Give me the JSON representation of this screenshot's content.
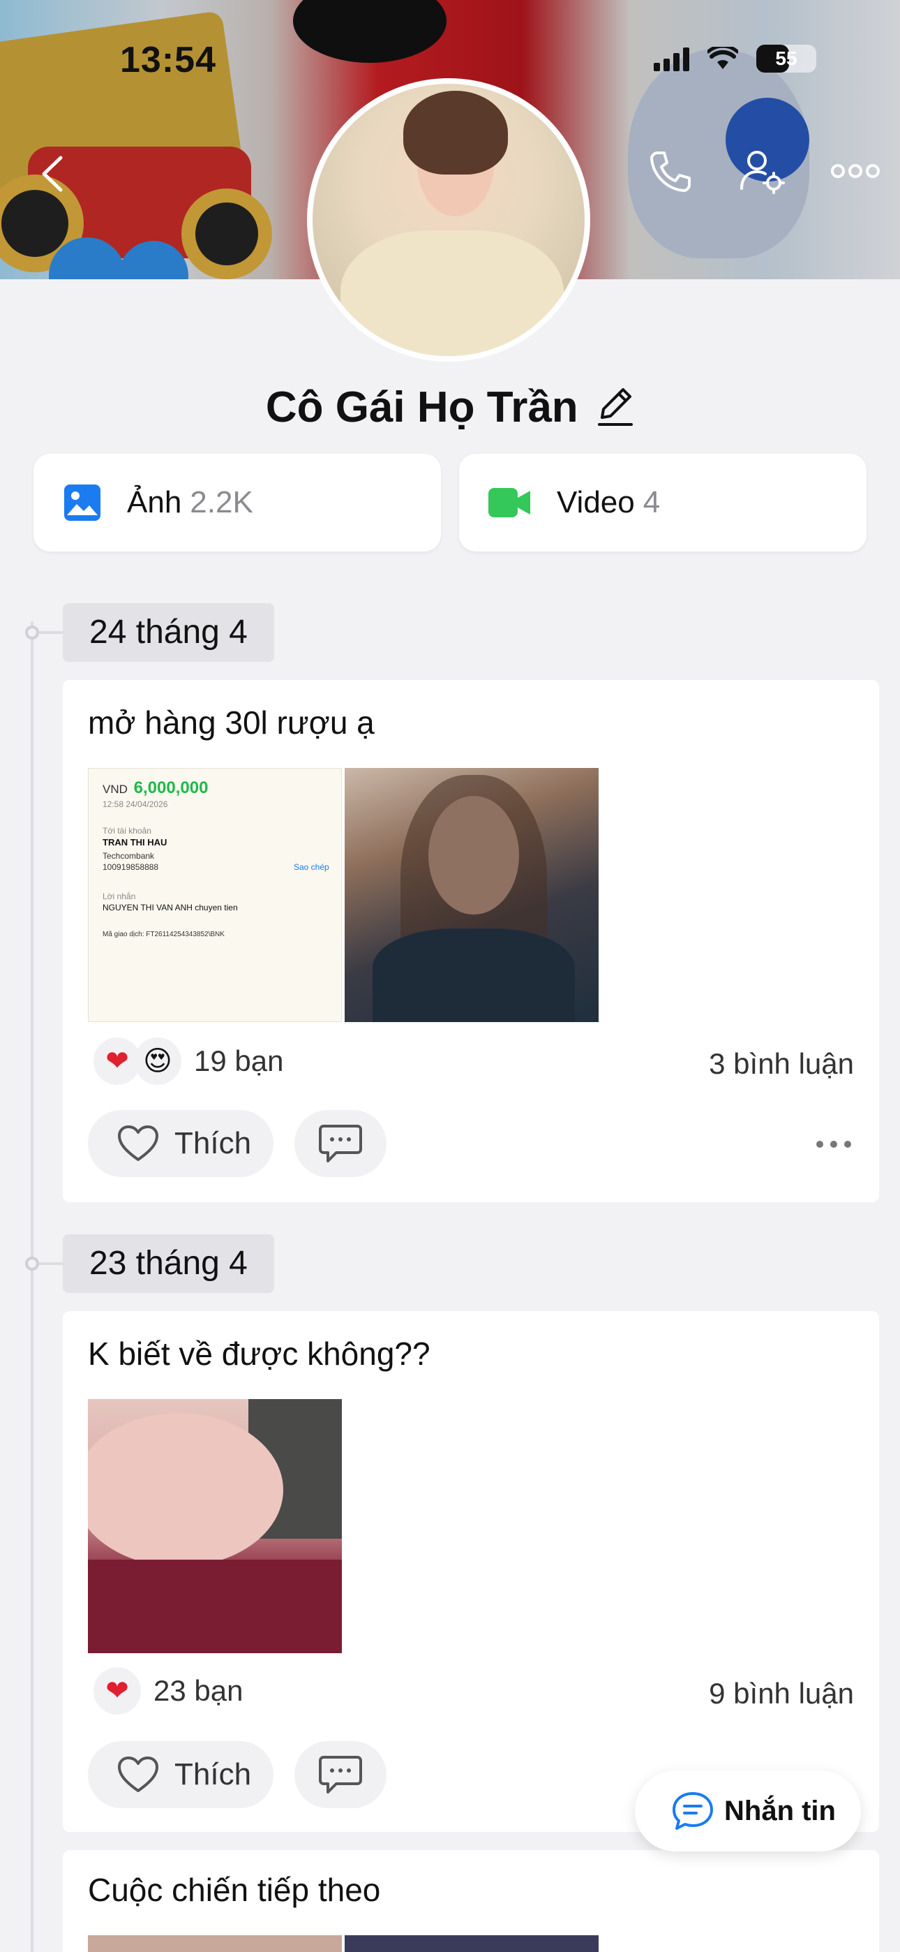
{
  "status_bar": {
    "time": "13:54",
    "battery": "55",
    "battery_level": 0.55
  },
  "profile": {
    "name": "Cô Gái Họ Trần"
  },
  "media": {
    "photos": {
      "label": "Ảnh",
      "count": "2.2K"
    },
    "videos": {
      "label": "Video",
      "count": "4"
    }
  },
  "posts": [
    {
      "date": "24 tháng 4",
      "text": "mở hàng 30l rượu ạ",
      "receipt": {
        "currency": "VND",
        "amount": "6,000,000",
        "time": "12:58 24/04/2026",
        "to_label": "Tới tài khoản",
        "account_name": "TRAN THI HAU",
        "bank": "Techcombank",
        "account_no": "100919858888",
        "copy_label": "Sao chép",
        "msg_label": "Lời nhắn",
        "message": "NGUYEN THI VAN ANH chuyen tien",
        "tx": "Mã giao dịch: FT26114254343852\\BNK"
      },
      "reactions_count": "19 bạn",
      "comments": "3 bình luận",
      "like_label": "Thích"
    },
    {
      "date": "23 tháng 4",
      "text": "K biết về được không??",
      "reactions_count": "23 bạn",
      "comments": "9 bình luận",
      "like_label": "Thích"
    },
    {
      "text": "Cuộc chiến tiếp theo"
    }
  ],
  "message_button": {
    "label": "Nhắn tin"
  },
  "colors": {
    "accent_blue": "#1a7cf0",
    "video_green": "#34c759",
    "heart_red": "#e0202e"
  }
}
